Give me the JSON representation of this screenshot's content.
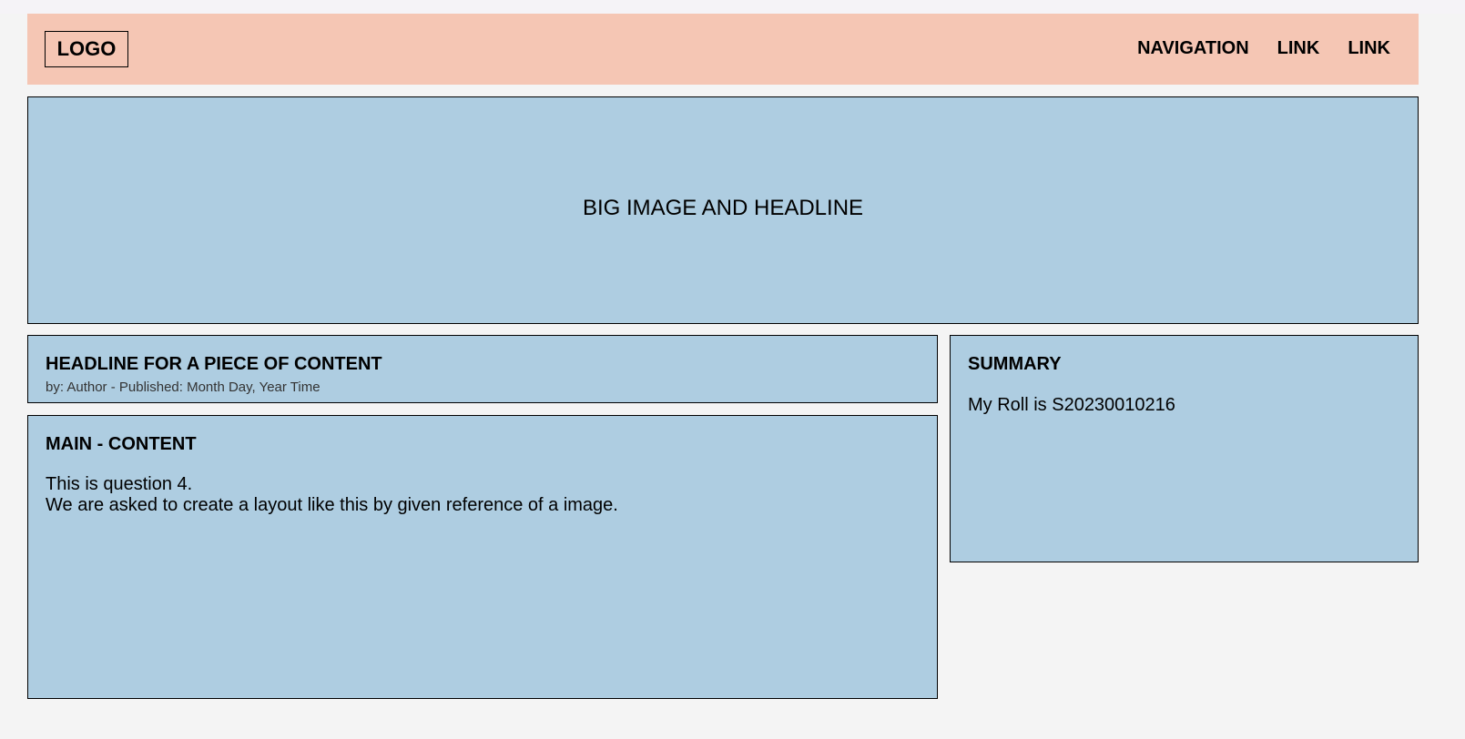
{
  "header": {
    "logo": "LOGO",
    "nav": [
      "NAVIGATION",
      "LINK",
      "LINK"
    ]
  },
  "hero": {
    "text": "BIG IMAGE AND HEADLINE"
  },
  "content_header": {
    "title": "HEADLINE FOR A PIECE OF CONTENT",
    "byline": "by: Author - Published: Month Day, Year Time"
  },
  "main_content": {
    "title": "MAIN - CONTENT",
    "lines": [
      "This is question 4.",
      "We are asked to create a layout like this by given reference of a image."
    ]
  },
  "summary": {
    "title": "SUMMARY",
    "text": "My Roll is S20230010216"
  },
  "colors": {
    "header_bg": "#f5c6b4",
    "panel_bg": "#aecde1",
    "page_bg": "#f4f4f4"
  }
}
